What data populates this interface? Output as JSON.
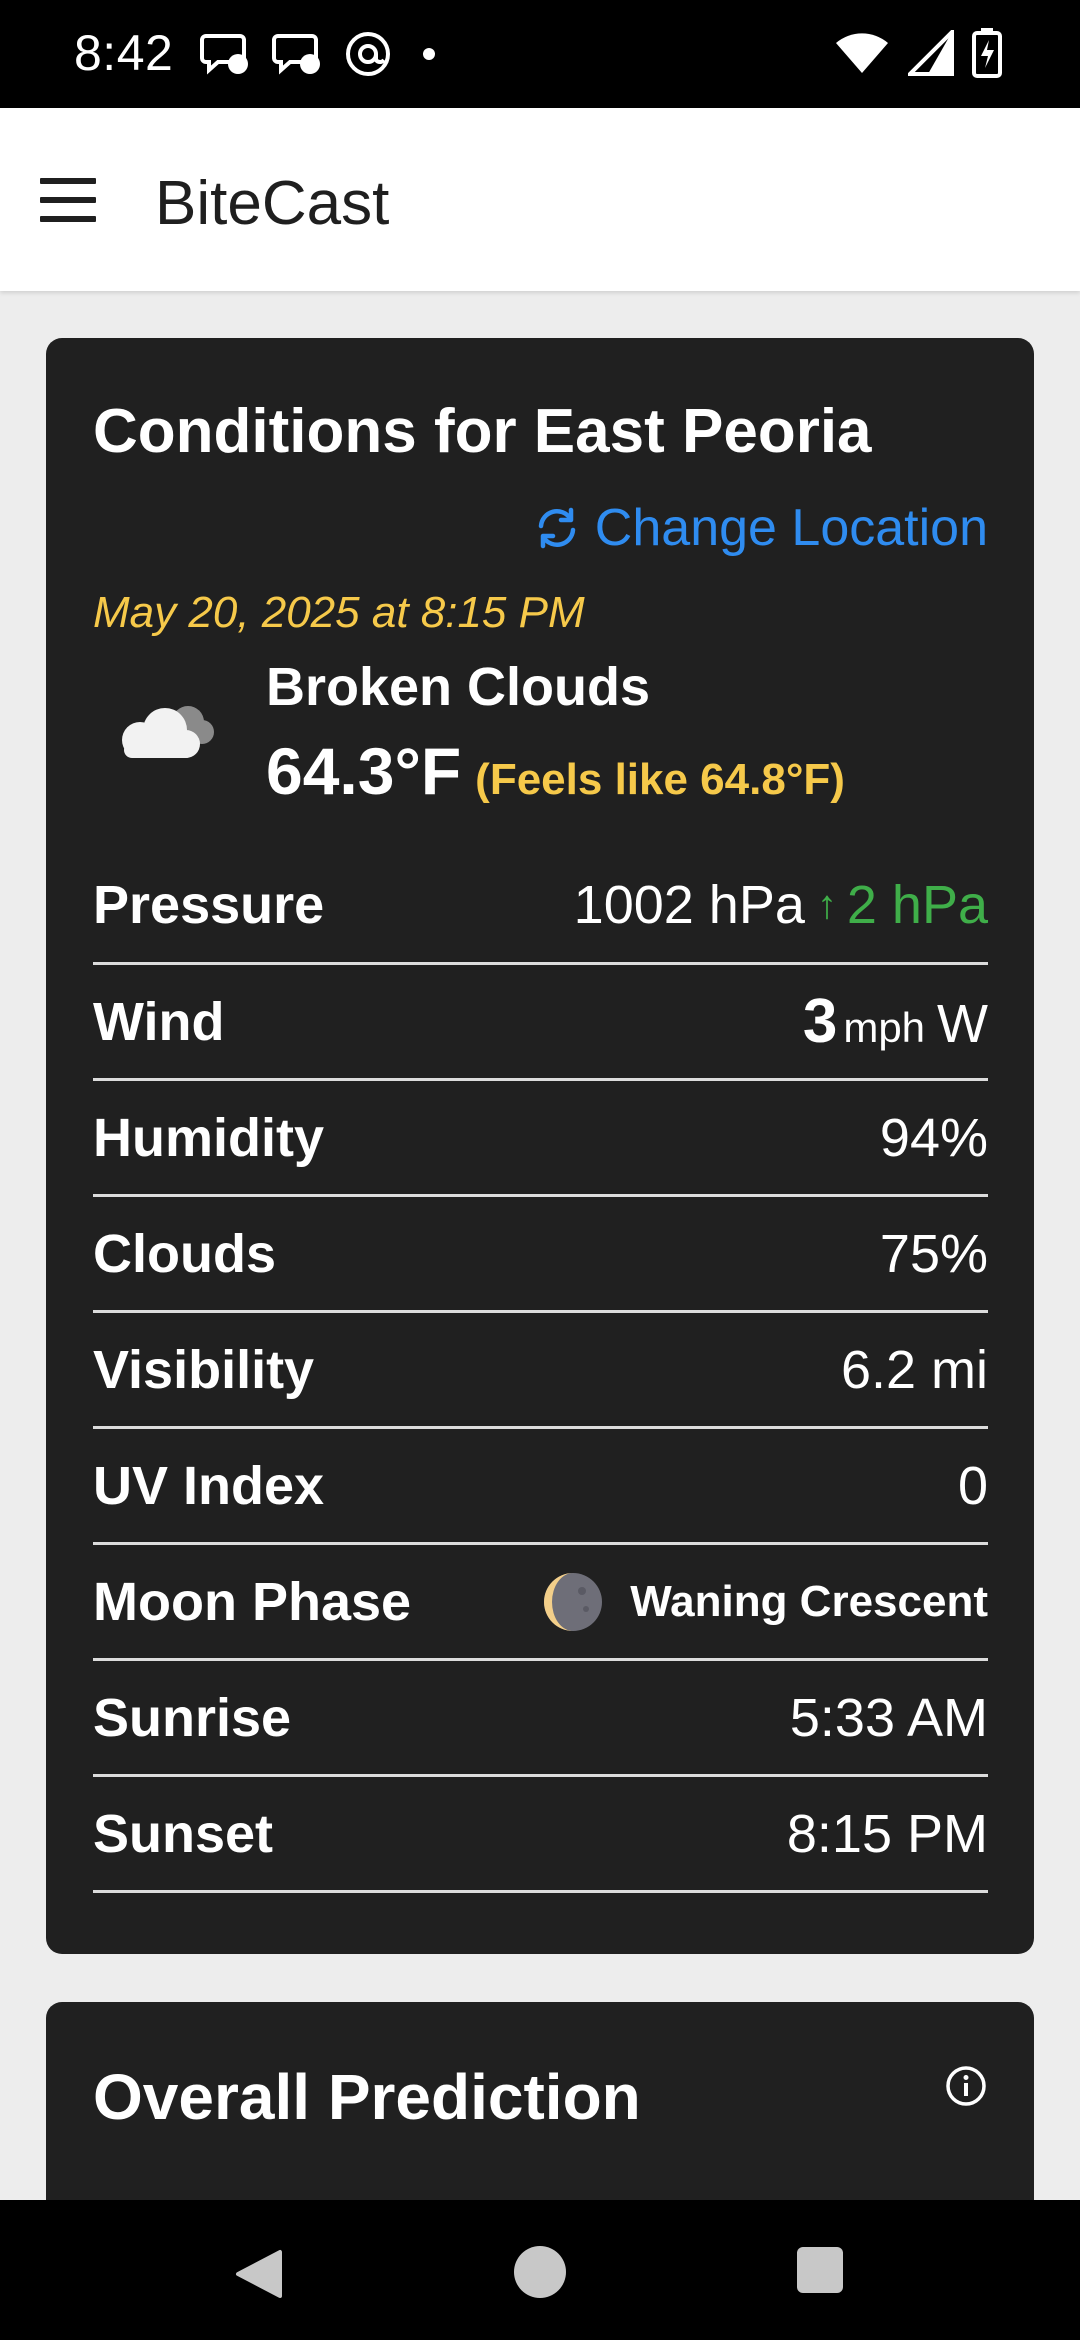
{
  "status_bar": {
    "time": "8:42",
    "left_icons": [
      "chat-icon",
      "chat-icon",
      "threads-icon",
      "dot-icon"
    ],
    "right_icons": [
      "wifi-icon",
      "signal-icon",
      "battery-charging-icon"
    ]
  },
  "app_bar": {
    "title": "BiteCast",
    "menu_icon": "menu-icon"
  },
  "conditions": {
    "title": "Conditions for East Peoria",
    "change_location_label": "Change Location",
    "timestamp": "May 20, 2025 at 8:15 PM",
    "weather_icon": "cloud-icon",
    "description": "Broken Clouds",
    "temperature": "64.3°F",
    "feels_like": "(Feels like 64.8°F)",
    "rows": {
      "pressure": {
        "label": "Pressure",
        "value": "1002 hPa",
        "change": "2 hPa",
        "change_arrow": "↑"
      },
      "wind": {
        "label": "Wind",
        "speed": "3",
        "unit": "mph",
        "direction": "W"
      },
      "humidity": {
        "label": "Humidity",
        "value": "94%"
      },
      "clouds": {
        "label": "Clouds",
        "value": "75%"
      },
      "visibility": {
        "label": "Visibility",
        "value": "6.2 mi"
      },
      "uv": {
        "label": "UV Index",
        "value": "0"
      },
      "moon": {
        "label": "Moon Phase",
        "value": "Waning Crescent",
        "icon": "moon-icon"
      },
      "sunrise": {
        "label": "Sunrise",
        "value": "5:33 AM"
      },
      "sunset": {
        "label": "Sunset",
        "value": "8:15 PM"
      }
    }
  },
  "prediction": {
    "title": "Overall Prediction",
    "info_icon": "info-icon"
  },
  "colors": {
    "accent_blue": "#2f8cf0",
    "highlight_yellow": "#f6c94a",
    "positive_green": "#3fae49",
    "card_bg": "#202020"
  }
}
